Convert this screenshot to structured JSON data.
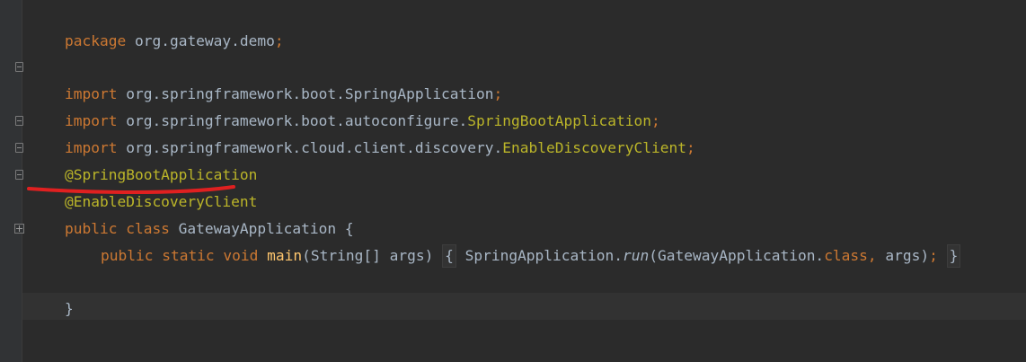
{
  "code": {
    "line1": {
      "kw": "package",
      "pkg": " org.gateway.demo",
      "semi": ";"
    },
    "line2": {
      "kw": "import",
      "pkg": " org.springframework.boot.SpringApplication",
      "semi": ";"
    },
    "line3": {
      "kw": "import",
      "pkg": " org.springframework.boot.autoconfigure.",
      "cls": "SpringBootApplication",
      "semi": ";"
    },
    "line4": {
      "kw": "import",
      "pkg": " org.springframework.cloud.client.discovery.",
      "cls": "EnableDiscoveryClient",
      "semi": ";"
    },
    "line5": {
      "ann": "@SpringBootApplication"
    },
    "line6": {
      "ann": "@EnableDiscoveryClient"
    },
    "line7": {
      "kw": "public class",
      "rest": " GatewayApplication {"
    },
    "line8": {
      "kw": "public static void",
      "method": "main",
      "params": "(String[] args)",
      "open": "{",
      "call_pre": " SpringApplication.",
      "call_method": "run",
      "call_args": "(GatewayApplication.",
      "class_kw": "class",
      "comma": ",",
      "call_tail": " args)",
      "semi": ";",
      "close": "}"
    },
    "line9": {
      "text": "}"
    }
  },
  "colors": {
    "background": "#2b2b2b",
    "keyword": "#cc7832",
    "annotation": "#bbb529",
    "text": "#a9b7c6",
    "method": "#ffc66d",
    "highlight_mark": "#e02020"
  }
}
